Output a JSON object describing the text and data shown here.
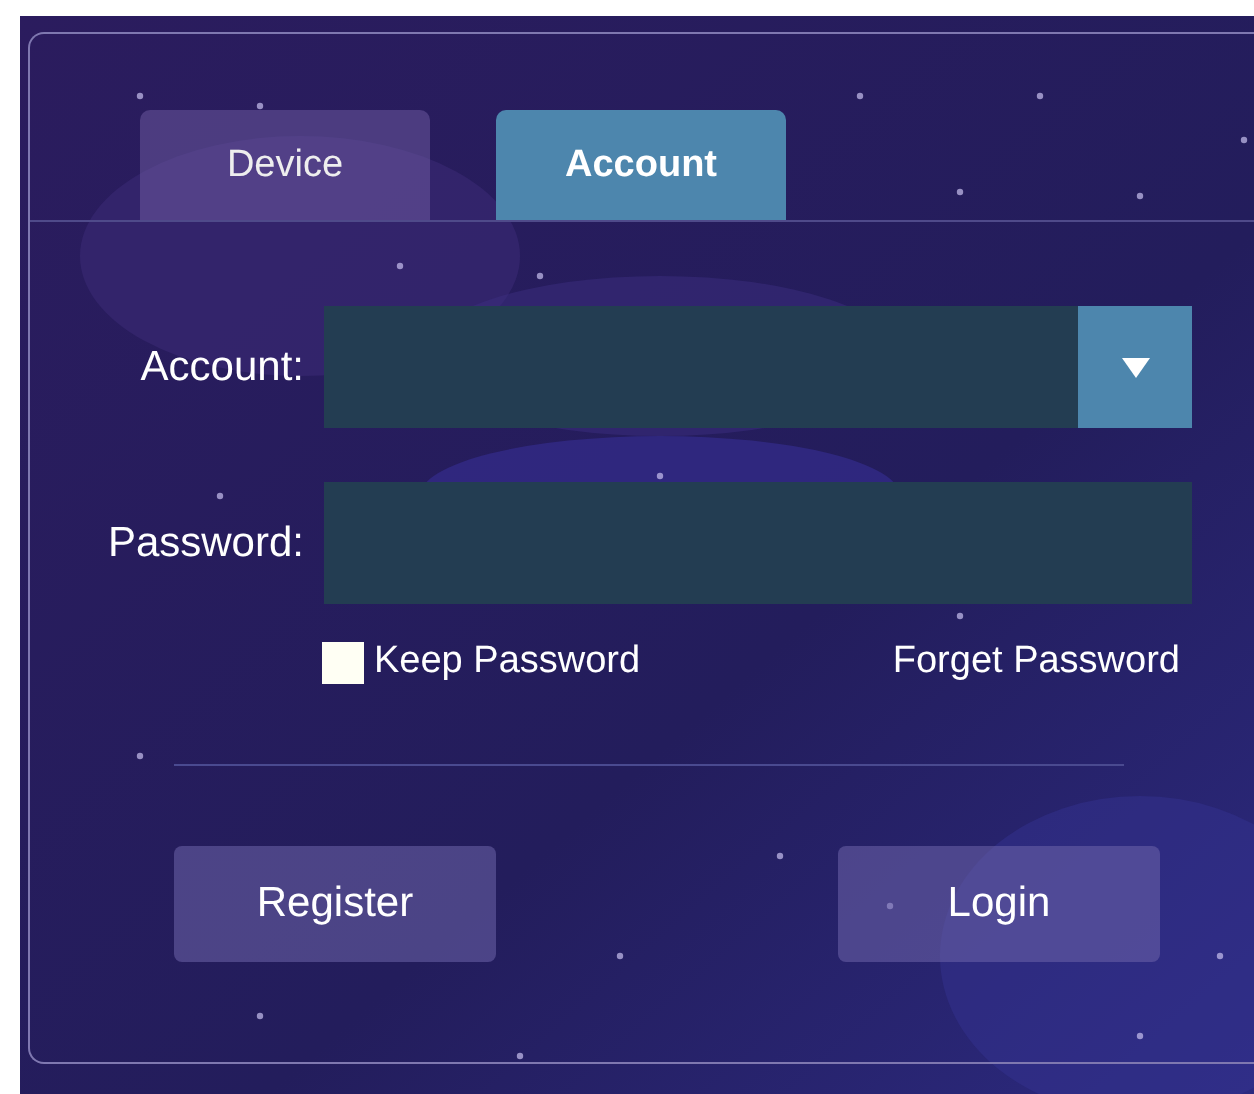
{
  "tabs": [
    {
      "label": "Device",
      "selected": false
    },
    {
      "label": "Account",
      "selected": true
    }
  ],
  "fields": [
    {
      "kind": "dropdown",
      "label": "Account:"
    },
    {
      "kind": "text",
      "label": "Password:"
    }
  ],
  "keep_password": {
    "label": "Keep Password",
    "checked": false
  },
  "forget_link": "Forget Password",
  "buttons": [
    "Register",
    "Login"
  ]
}
